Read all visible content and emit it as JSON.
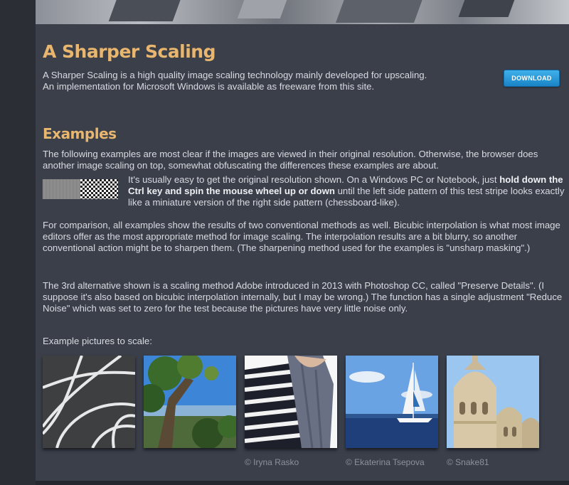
{
  "header": {
    "title": "A Sharper Scaling"
  },
  "intro": {
    "line1": "A Sharper Scaling is a high quality image scaling technology mainly developed for upscaling.",
    "line2": "An implementation for Microsoft Windows is available as freeware from this site."
  },
  "download": {
    "label": "DOWNLOAD"
  },
  "examples": {
    "heading": "Examples",
    "p1": "The following examples are most clear if the images are viewed in their original resolution. Otherwise, the browser does another image scaling on top, somewhat obfuscating the differences these examples are about.",
    "p2_a": "It's usually easy to get the original resolution shown. On a Windows PC or Notebook, just ",
    "p2_b": "hold down the Ctrl key and spin the mouse wheel up or down",
    "p2_c": " until the left side pattern of this test stripe looks exactly like a miniature version of the right side pattern (chessboard-like).",
    "p3": "For comparison, all examples show the results of two conventional methods as well. Bicubic interpolation is what most image editors offer as the most appropriate method for image scaling. The interpolation results are a bit blurry, so another conventional action might be to sharpen them. (The sharpening method used for the examples is \"unsharp masking\".)",
    "p4": "The 3rd alternative shown is a scaling method Adobe introduced in 2013 with Photoshop CC, called \"Preserve Details\". (I suppose it's also based on bicubic interpolation internally, but I may be wrong.) The function has a single adjustment \"Reduce Noise\" which was set to zero for the test because the pictures have very little noise only.",
    "p5": "Example pictures to scale:"
  },
  "thumbnails": [
    {
      "name": "arcs",
      "credit": ""
    },
    {
      "name": "tree",
      "credit": ""
    },
    {
      "name": "scarf",
      "credit": "© Iryna Rasko"
    },
    {
      "name": "sailboat",
      "credit": "© Ekaterina Tsepova"
    },
    {
      "name": "basilica",
      "credit": "© Snake81"
    }
  ],
  "colors": {
    "heading": "#e9b66f",
    "background": "#3a3f4a",
    "button": "#1f8ccf"
  }
}
